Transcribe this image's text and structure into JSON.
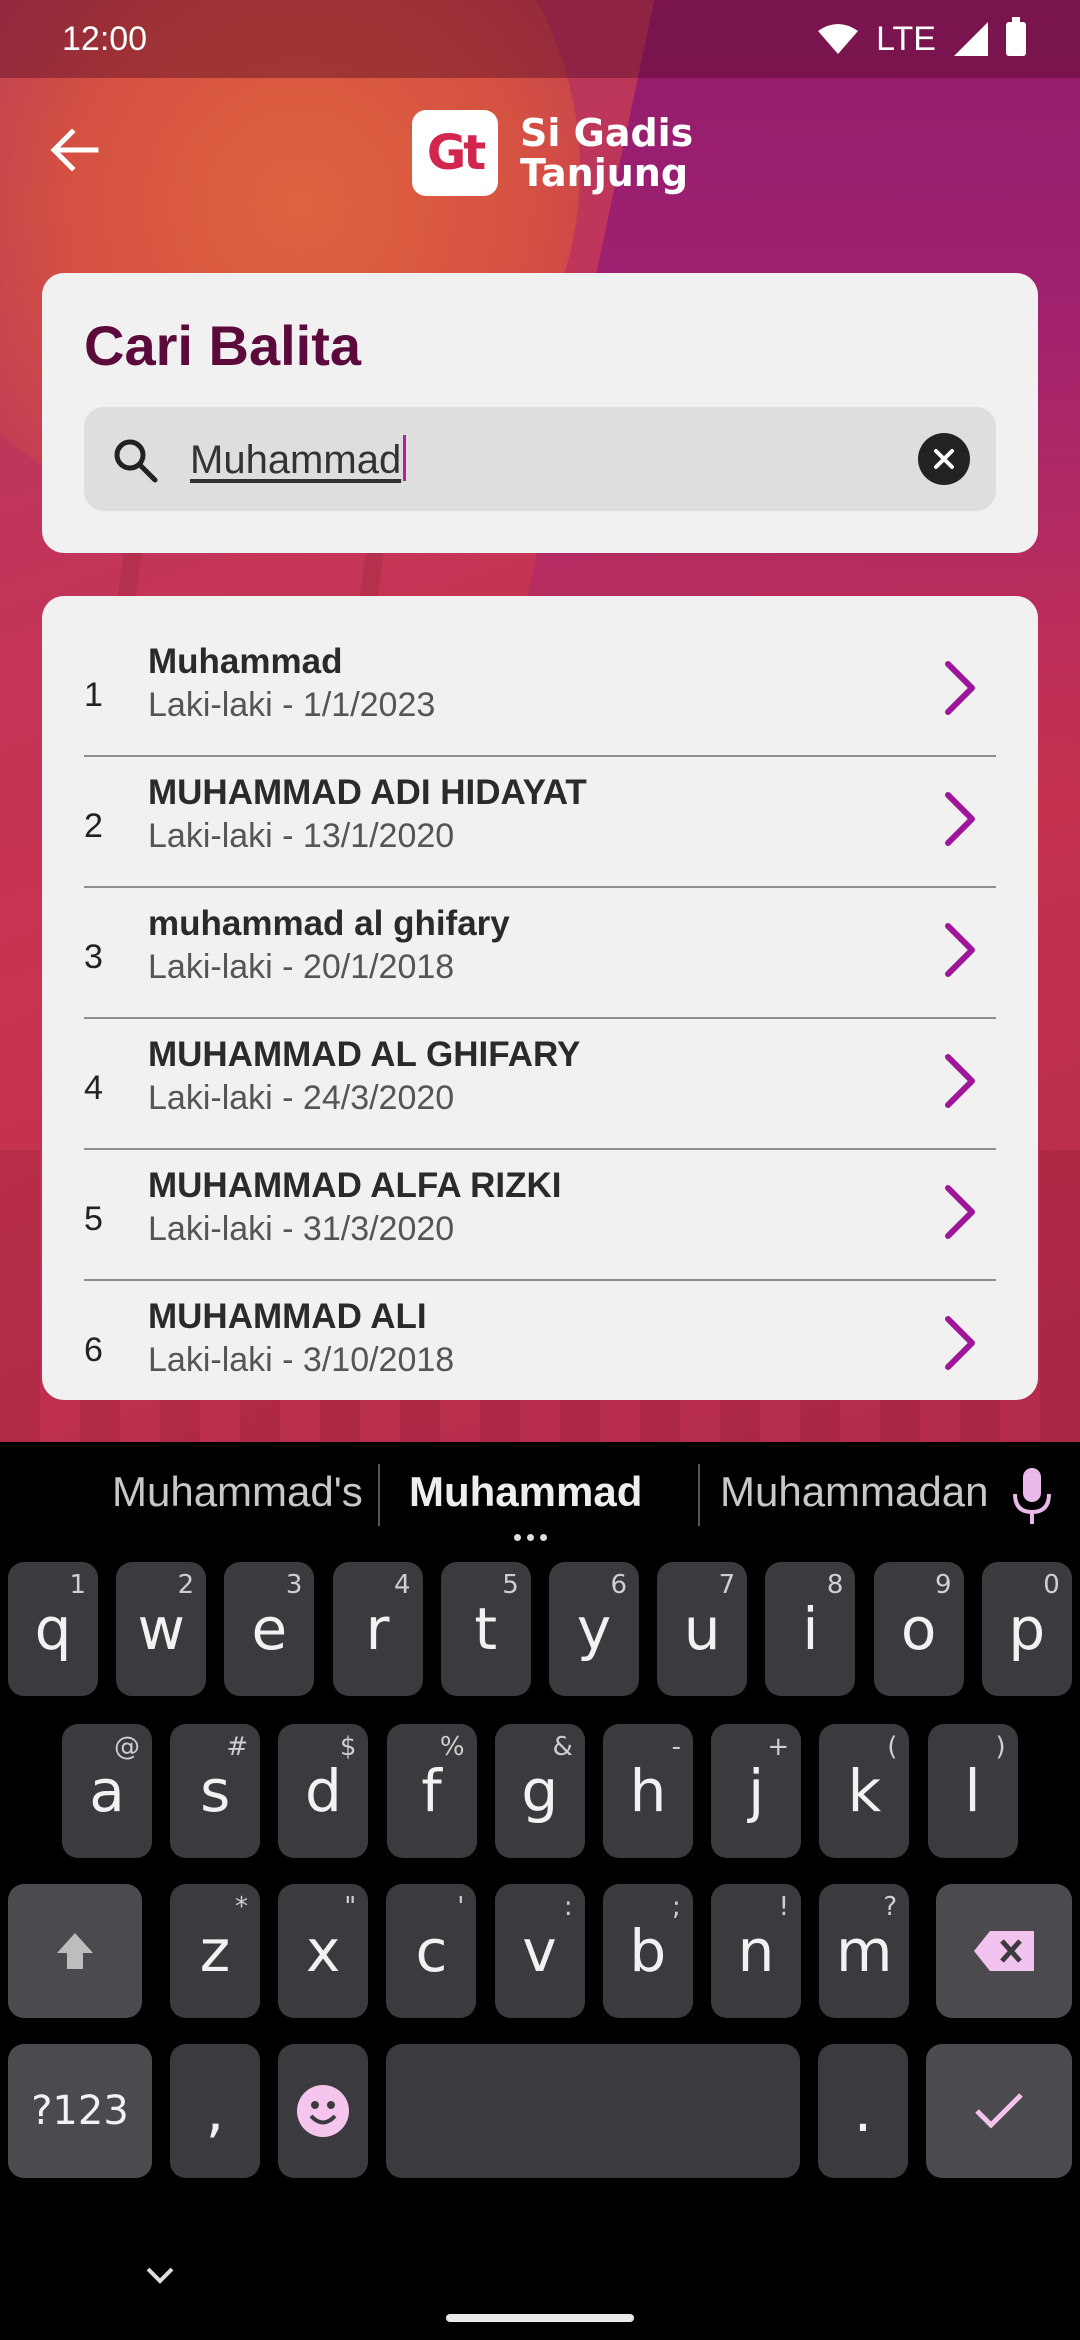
{
  "status_bar": {
    "time": "12:00",
    "network": "LTE"
  },
  "app_bar": {
    "logo_mark": "Gt",
    "logo_line1": "Si Gadis",
    "logo_line2": "Tanjung"
  },
  "search": {
    "title": "Cari Balita",
    "query": "Muhammad"
  },
  "results": [
    {
      "num": "1",
      "name": "Muhammad",
      "info": "Laki-laki - 1/1/2023"
    },
    {
      "num": "2",
      "name": "MUHAMMAD ADI HIDAYAT",
      "info": "Laki-laki - 13/1/2020"
    },
    {
      "num": "3",
      "name": "muhammad al ghifary",
      "info": "Laki-laki - 20/1/2018"
    },
    {
      "num": "4",
      "name": "MUHAMMAD AL GHIFARY",
      "info": "Laki-laki - 24/3/2020"
    },
    {
      "num": "5",
      "name": "MUHAMMAD ALFA RIZKI",
      "info": "Laki-laki - 31/3/2020"
    },
    {
      "num": "6",
      "name": "MUHAMMAD ALI",
      "info": "Laki-laki - 3/10/2018"
    }
  ],
  "keyboard": {
    "suggestions": [
      "Muhammad's",
      "Muhammad",
      "Muhammadan"
    ],
    "row1": [
      [
        "q",
        "1"
      ],
      [
        "w",
        "2"
      ],
      [
        "e",
        "3"
      ],
      [
        "r",
        "4"
      ],
      [
        "t",
        "5"
      ],
      [
        "y",
        "6"
      ],
      [
        "u",
        "7"
      ],
      [
        "i",
        "8"
      ],
      [
        "o",
        "9"
      ],
      [
        "p",
        "0"
      ]
    ],
    "row2": [
      [
        "a",
        "@"
      ],
      [
        "s",
        "#"
      ],
      [
        "d",
        "$"
      ],
      [
        "f",
        "%"
      ],
      [
        "g",
        "&"
      ],
      [
        "h",
        "-"
      ],
      [
        "j",
        "+"
      ],
      [
        "k",
        "("
      ],
      [
        "l",
        ")"
      ]
    ],
    "row3": [
      [
        "z",
        "*"
      ],
      [
        "x",
        "\""
      ],
      [
        "c",
        "'"
      ],
      [
        "v",
        ":"
      ],
      [
        "b",
        ";"
      ],
      [
        "n",
        "!"
      ],
      [
        "m",
        "?"
      ]
    ],
    "symbols_key": "?123",
    "comma_key": ",",
    "period_key": "."
  },
  "colors": {
    "accent": "#a0169a",
    "title": "#5c0a3c",
    "card": "#f1f1f1"
  }
}
